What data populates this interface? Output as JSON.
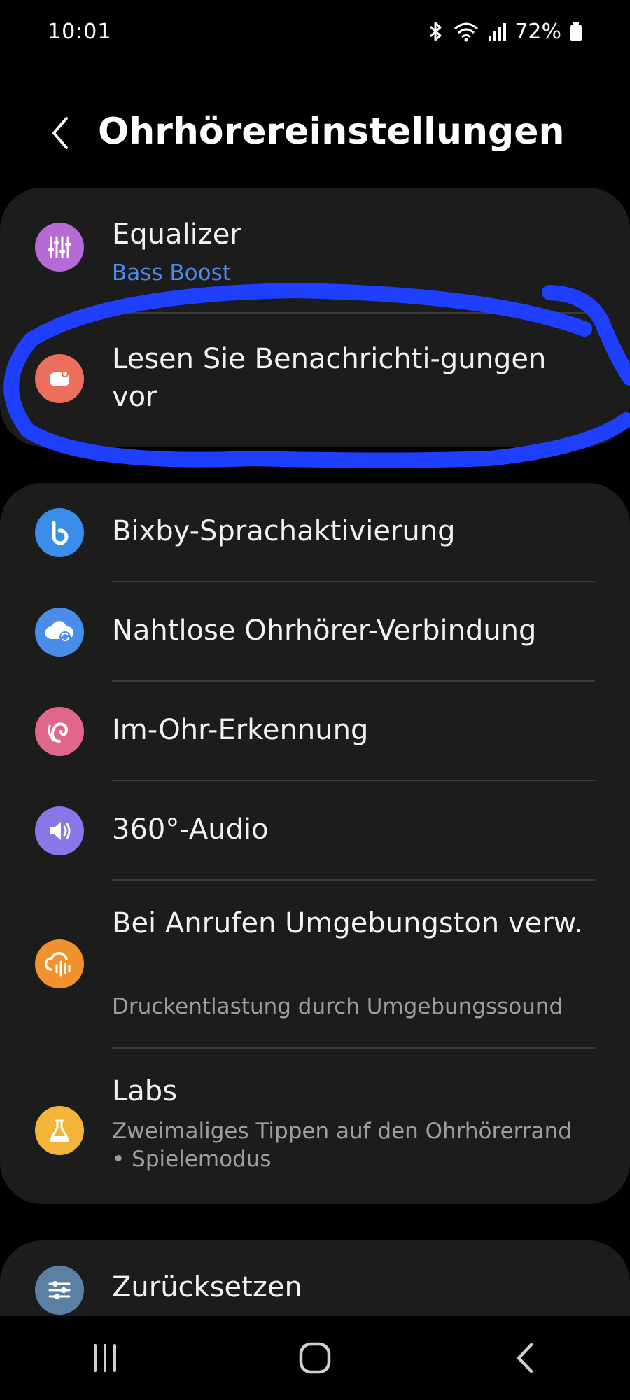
{
  "status": {
    "time": "10:01",
    "battery": "72%"
  },
  "header": {
    "title": "Ohrhörereinstellungen"
  },
  "group1": [
    {
      "title": "Equalizer",
      "subtitle": "Bass Boost",
      "icon": "equalizer-icon",
      "color": "#b66ad6"
    },
    {
      "title": "Lesen Sie Benachrichti-gungen vor",
      "icon": "notification-icon",
      "color": "#ec6f5e"
    }
  ],
  "group2": [
    {
      "title": "Bixby-Sprachaktivierung",
      "icon": "bixby-icon",
      "color": "#3a8de8"
    },
    {
      "title": "Nahtlose Ohrhörer-Verbindung",
      "icon": "cloud-sync-icon",
      "color": "#4a8de8"
    },
    {
      "title": "Im-Ohr-Erkennung",
      "icon": "ear-icon",
      "color": "#e0678a"
    },
    {
      "title": "360°-Audio",
      "icon": "speaker-icon",
      "color": "#8a76e6"
    },
    {
      "title": "Bei Anrufen Umgebungston verw.",
      "subtitle": "Druckentlastung durch Umgebungssound",
      "icon": "ambient-sound-icon",
      "color": "#f0922e"
    },
    {
      "title": "Labs",
      "subtitle": "Zweimaliges Tippen auf den Ohrhörerrand",
      "subtitle2": "•  Spielemodus",
      "icon": "flask-icon",
      "color": "#f2b53a"
    }
  ],
  "group3": [
    {
      "title": "Zurücksetzen",
      "icon": "sliders-icon",
      "color": "#5c7fa6"
    }
  ],
  "colors": {
    "background": "#000000",
    "card": "#1c1c1c",
    "accent": "#4a8cf0",
    "scribble": "#1f3fff"
  }
}
